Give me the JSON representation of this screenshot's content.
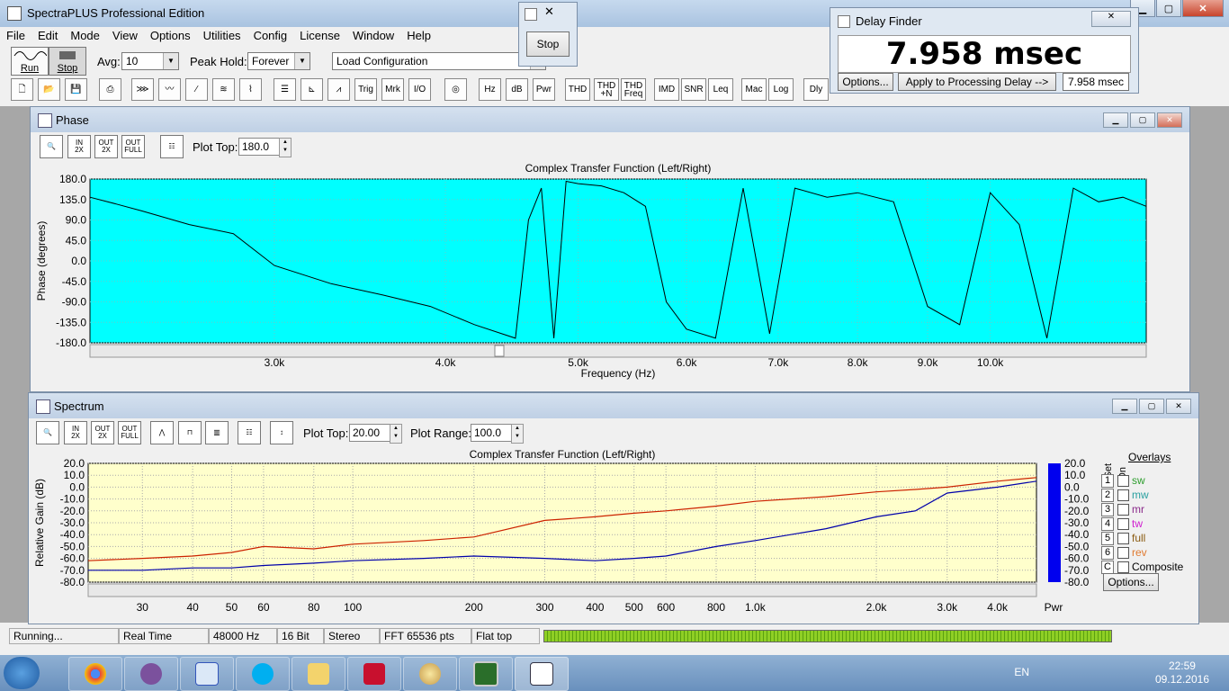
{
  "app": {
    "title": "SpectraPLUS Professional Edition"
  },
  "menu": [
    "File",
    "Edit",
    "Mode",
    "View",
    "Options",
    "Utilities",
    "Config",
    "License",
    "Window",
    "Help"
  ],
  "toolbar": {
    "run_label": "Run",
    "stop_label": "Stop",
    "avg_label": "Avg:",
    "avg_value": "10",
    "peak_hold_label": "Peak Hold:",
    "peak_hold_value": "Forever",
    "load_config": "Load Configuration",
    "buttons": [
      "Trig",
      "Mrk",
      "I/O",
      "Hz",
      "dB",
      "Pwr",
      "THD",
      "THD +N",
      "THD Freq",
      "IMD",
      "SNR",
      "Leq",
      "Mac",
      "Log",
      "Dly"
    ]
  },
  "stop_window": {
    "button": "Stop"
  },
  "delay_finder": {
    "title": "Delay Finder",
    "value": "7.958 msec",
    "options_button": "Options...",
    "apply_button": "Apply to Processing Delay -->",
    "result": "7.958 msec"
  },
  "phase_window": {
    "title": "Phase",
    "plot_top_label": "Plot Top:",
    "plot_top_value": "180.0",
    "chart_title": "Complex Transfer Function (Left/Right)",
    "ylabel": "Phase (degrees)",
    "xlabel": "Frequency (Hz)",
    "yticks": [
      "180.0",
      "135.0",
      "90.0",
      "45.0",
      "0.0",
      "-45.0",
      "-90.0",
      "-135.0",
      "-180.0"
    ],
    "xticks": [
      "3.0k",
      "4.0k",
      "5.0k",
      "6.0k",
      "7.0k",
      "8.0k",
      "9.0k",
      "10.0k"
    ],
    "bg_color": "#00ffff"
  },
  "spectrum_window": {
    "title": "Spectrum",
    "plot_top_label": "Plot Top:",
    "plot_top_value": "20.00",
    "plot_range_label": "Plot Range:",
    "plot_range_value": "100.0",
    "chart_title": "Complex Transfer Function (Left/Right)",
    "ylabel": "Relative Gain (dB)",
    "yticks": [
      "20.0",
      "10.0",
      "0.0",
      "-10.0",
      "-20.0",
      "-30.0",
      "-40.0",
      "-50.0",
      "-60.0",
      "-70.0",
      "-80.0"
    ],
    "xticks": [
      "30",
      "40",
      "50",
      "60",
      "80",
      "100",
      "200",
      "300",
      "400",
      "500",
      "600",
      "800",
      "1.0k",
      "2.0k",
      "3.0k",
      "4.0k"
    ],
    "bar_label": "Pwr",
    "bg_color": "#ffffcc",
    "overlays": {
      "title": "Overlays",
      "set_label": "Set",
      "on_label": "On",
      "items": [
        {
          "num": "1",
          "name": "sw",
          "color": "#2e9e2e"
        },
        {
          "num": "2",
          "name": "mw",
          "color": "#2aa0a0"
        },
        {
          "num": "3",
          "name": "mr",
          "color": "#8a2a8a"
        },
        {
          "num": "4",
          "name": "tw",
          "color": "#d020d0"
        },
        {
          "num": "5",
          "name": "full",
          "color": "#8a5a10"
        },
        {
          "num": "6",
          "name": "rev",
          "color": "#e07a30"
        },
        {
          "num": "C",
          "name": "Composite",
          "color": "#000000"
        }
      ],
      "options_button": "Options..."
    }
  },
  "chart_data": [
    {
      "type": "line",
      "title": "Complex Transfer Function (Left/Right)",
      "xlabel": "Frequency (Hz)",
      "ylabel": "Phase (degrees)",
      "xscale": "log",
      "xlim": [
        2200,
        13000
      ],
      "ylim": [
        -180,
        180
      ],
      "series": [
        {
          "x": [
            2200,
            2300,
            2400,
            2600,
            2800,
            3000,
            3300,
            3600,
            3900,
            4200,
            4500,
            4600,
            4700,
            4800,
            4900,
            5000,
            5200,
            5400,
            5600,
            5800,
            6000,
            6300,
            6600,
            6900,
            7200,
            7600,
            8000,
            8500,
            9000,
            9500,
            10000,
            10500,
            11000,
            11500,
            12000,
            12500,
            13000
          ],
          "y": [
            140,
            125,
            110,
            80,
            60,
            -10,
            -50,
            -75,
            -100,
            -140,
            -170,
            90,
            160,
            -170,
            175,
            170,
            165,
            150,
            120,
            -90,
            -150,
            -170,
            160,
            -160,
            160,
            140,
            150,
            130,
            -100,
            -140,
            150,
            80,
            -170,
            160,
            130,
            140,
            120
          ]
        }
      ]
    },
    {
      "type": "line",
      "title": "Complex Transfer Function (Left/Right)",
      "ylabel": "Relative Gain (dB)",
      "xscale": "log",
      "xlim": [
        22,
        5000
      ],
      "ylim": [
        -80,
        20
      ],
      "series": [
        {
          "color": "#cc2200",
          "x": [
            22,
            30,
            40,
            50,
            60,
            80,
            100,
            150,
            200,
            300,
            400,
            500,
            600,
            800,
            1000,
            1500,
            2000,
            2500,
            3000,
            4000,
            5000
          ],
          "y": [
            -62,
            -60,
            -58,
            -55,
            -50,
            -52,
            -48,
            -45,
            -42,
            -28,
            -25,
            -22,
            -20,
            -16,
            -12,
            -8,
            -4,
            -2,
            0,
            5,
            8
          ]
        },
        {
          "color": "#0000aa",
          "x": [
            22,
            30,
            40,
            50,
            60,
            80,
            100,
            150,
            200,
            300,
            400,
            500,
            600,
            800,
            1000,
            1500,
            2000,
            2500,
            3000,
            4000,
            5000
          ],
          "y": [
            -70,
            -70,
            -68,
            -68,
            -66,
            -64,
            -62,
            -60,
            -58,
            -60,
            -62,
            -60,
            -58,
            -50,
            -45,
            -35,
            -25,
            -20,
            -5,
            0,
            5
          ]
        }
      ]
    }
  ],
  "status": {
    "state": "Running...",
    "mode": "Real Time",
    "rate": "48000 Hz",
    "bits": "16 Bit",
    "channels": "Stereo",
    "fft": "FFT 65536 pts",
    "window": "Flat top"
  },
  "taskbar": {
    "lang": "EN",
    "time": "22:59",
    "date": "09.12.2016"
  }
}
